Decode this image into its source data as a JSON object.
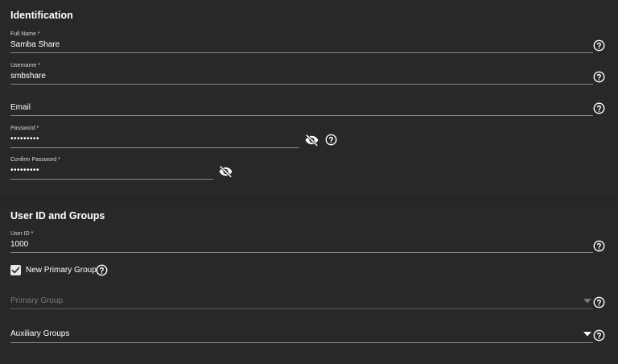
{
  "identification": {
    "title": "Identification",
    "full_name": {
      "label": "Full Name *",
      "value": "Samba Share"
    },
    "username": {
      "label": "Username *",
      "value": "smbshare"
    },
    "email": {
      "placeholder": "Email"
    },
    "password": {
      "label": "Password *",
      "value": "•••••••••"
    },
    "confirm_password": {
      "label": "Confirm Password *",
      "value": "•••••••••"
    }
  },
  "user_groups": {
    "title": "User ID and Groups",
    "user_id": {
      "label": "User ID *",
      "value": "1000"
    },
    "new_primary_group": {
      "label": "New Primary Group",
      "checked": true
    },
    "primary_group": {
      "placeholder": "Primary Group"
    },
    "auxiliary_groups": {
      "placeholder": "Auxiliary Groups"
    }
  },
  "icons": {
    "help": "help-circle-icon",
    "visibility": "eye-off-icon",
    "dropdown": "caret-down-icon",
    "check": "check-icon"
  },
  "colors": {
    "background": "#282828",
    "text": "#ffffff",
    "underline": "#8a8a8a",
    "disabled": "#7a7a7a"
  }
}
